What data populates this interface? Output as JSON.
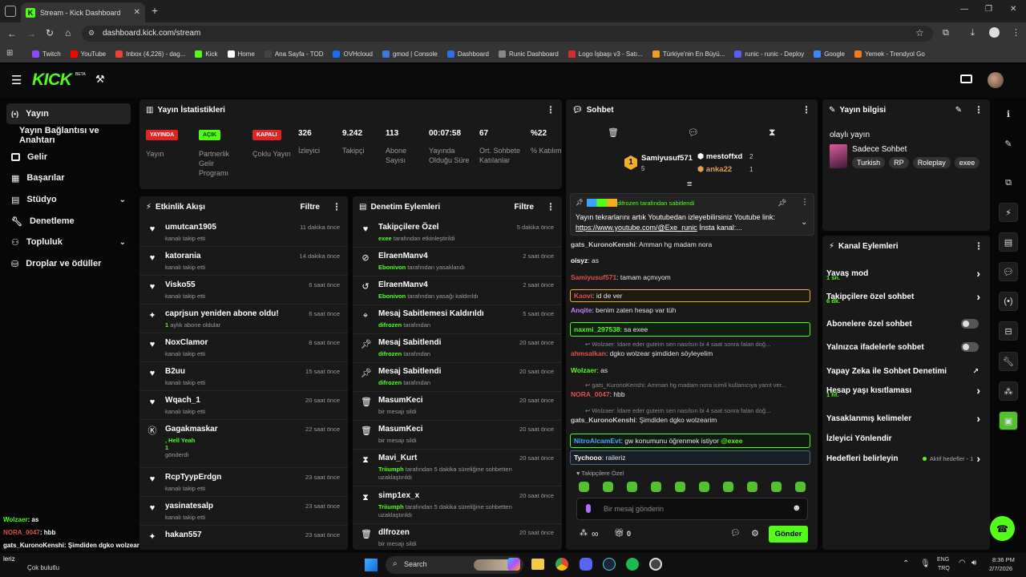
{
  "browser": {
    "tab_title": "Stream - Kick Dashboard",
    "url": "dashboard.kick.com/stream",
    "bookmarks": [
      {
        "label": "Twitch",
        "color": "#9146ff"
      },
      {
        "label": "YouTube",
        "color": "#ff0000"
      },
      {
        "label": "Inbox (4,226) - dag...",
        "color": "#ea4335"
      },
      {
        "label": "Kick",
        "color": "#53fc18"
      },
      {
        "label": "Home",
        "color": "#ffffff"
      },
      {
        "label": "Ana Sayfa - TOD",
        "color": "#444444"
      },
      {
        "label": "OVHcloud",
        "color": "#1c6cf0"
      },
      {
        "label": "gmod | Console",
        "color": "#3a7bd5"
      },
      {
        "label": "Dashboard",
        "color": "#2f6fed"
      },
      {
        "label": "Runic Dashboard",
        "color": "#888888"
      },
      {
        "label": "Logo İşbaşı v3 - Satı...",
        "color": "#d03030"
      },
      {
        "label": "Türkiye'nin En Büyü...",
        "color": "#f0a020"
      },
      {
        "label": "runic - runic - Deploy",
        "color": "#5a5aff"
      },
      {
        "label": "Google",
        "color": "#4285f4"
      },
      {
        "label": "Yemek - Trendyol Go",
        "color": "#f27a1a"
      }
    ]
  },
  "sidebar": {
    "items": [
      {
        "label": "Yayın",
        "icon": "broadcast-icon"
      },
      {
        "label": "Yayın Bağlantısı ve Anahtarı",
        "icon": ""
      },
      {
        "label": "Gelir",
        "icon": "revenue-icon"
      },
      {
        "label": "Başarılar",
        "icon": "achievements-icon"
      },
      {
        "label": "Stüdyo",
        "icon": "studio-icon"
      },
      {
        "label": "Denetleme",
        "icon": "wrench-icon"
      },
      {
        "label": "Topluluk",
        "icon": "community-icon"
      },
      {
        "label": "Droplar ve ödüller",
        "icon": "drops-icon"
      }
    ]
  },
  "stats": {
    "title": "Yayın İstatistikleri",
    "badges": [
      {
        "badge": "YAYINDA",
        "label": "Yayın",
        "color": "#e02424",
        "text": "#ffffff"
      },
      {
        "badge": "AÇIK",
        "label": "Partnerlik Gelir Programı",
        "color": "#53fc18",
        "text": "#0b3d00"
      },
      {
        "badge": "KAPALI",
        "label": "Çoklu Yayın",
        "color": "#e02424",
        "text": "#ffffff"
      }
    ],
    "numbers": [
      {
        "value": "326",
        "label": "İzleyici"
      },
      {
        "value": "9.242",
        "label": "Takipçi"
      },
      {
        "value": "113",
        "label": "Abone Sayısı"
      },
      {
        "value": "00:07:58",
        "label": "Yayında Olduğu Süre"
      },
      {
        "value": "67",
        "label": "Ort. Sohbete Katılanlar"
      },
      {
        "value": "%22",
        "label": "% Katılım"
      }
    ]
  },
  "activity": {
    "title": "Etkinlik Akışı",
    "filter": "Filtre",
    "rows": [
      {
        "name": "umutcan1905",
        "sub": "kanalı takip etti",
        "time": "11 dakika önce",
        "icon": "heart-icon"
      },
      {
        "name": "katorania",
        "sub": "kanalı takip etti",
        "time": "14 dakika önce",
        "icon": "heart-icon"
      },
      {
        "name": "Visko55",
        "sub": "kanalı takip etti",
        "time": "6 saat önce",
        "icon": "heart-icon"
      },
      {
        "name": "caprjsun yeniden abone oldu!",
        "sub_hl": "1",
        "sub": " aylık abone oldular",
        "time": "6 saat önce",
        "icon": "sparkle-icon"
      },
      {
        "name": "NoxClamor",
        "sub": "kanalı takip etti",
        "time": "8 saat önce",
        "icon": "heart-icon"
      },
      {
        "name": "B2uu",
        "sub": "kanalı takip etti",
        "time": "15 saat önce",
        "icon": "heart-icon"
      },
      {
        "name": "Wqach_1",
        "sub": "kanalı takip etti",
        "time": "20 saat önce",
        "icon": "heart-icon"
      },
      {
        "name": "Gagakmaskar",
        "sub_hl": ", Hell Yeah",
        "sub2": "1",
        "sub": "gönderdi",
        "time": "22 saat önce",
        "icon": "kick-icon"
      },
      {
        "name": "RcpTyypErdgn",
        "sub": "kanalı takip etti",
        "time": "23 saat önce",
        "icon": "heart-icon"
      },
      {
        "name": "yasinatesalp",
        "sub": "kanalı takip etti",
        "time": "23 saat önce",
        "icon": "heart-icon"
      },
      {
        "name": "hakan557",
        "sub": "",
        "time": "23 saat önce",
        "icon": "sparkle-icon"
      }
    ]
  },
  "moderation": {
    "title": "Denetim Eylemleri",
    "filter": "Filtre",
    "rows": [
      {
        "name": "Takipçilere Özel",
        "who": "exee",
        "sub": " tarafından etkinleştirildi",
        "time": "5 dakika önce",
        "icon": "heart-icon"
      },
      {
        "name": "ElraenManv4",
        "who": "Ebonivon",
        "sub": " tarafından yasaklandı",
        "time": "2 saat önce",
        "icon": "ban-icon"
      },
      {
        "name": "ElraenManv4",
        "who": "Ebonivon",
        "sub": " tarafından yasağı kaldırıldı",
        "time": "2 saat önce",
        "icon": "undo-icon"
      },
      {
        "name": "Mesaj Sabitlemesi Kaldırıldı",
        "who": "difrozen",
        "sub": " tarafından",
        "time": "5 saat önce",
        "icon": "unpin-icon"
      },
      {
        "name": "Mesaj Sabitlendi",
        "who": "difrozen",
        "sub": " tarafından",
        "time": "20 saat önce",
        "icon": "pin-icon"
      },
      {
        "name": "Mesaj Sabitlendi",
        "who": "difrozen",
        "sub": " tarafından",
        "time": "20 saat önce",
        "icon": "pin-icon"
      },
      {
        "name": "MasumKeci",
        "who": "",
        "sub": "bir mesajı sildi",
        "time": "20 saat önce",
        "icon": "trash-icon"
      },
      {
        "name": "MasumKeci",
        "who": "",
        "sub": "bir mesajı sildi",
        "time": "20 saat önce",
        "icon": "trash-icon"
      },
      {
        "name": "Mavi_Kurt",
        "who": "Triiumph",
        "sub": " tarafından 5 dakika süreliğine sohbetten uzaklaştırıldı",
        "time": "20 saat önce",
        "icon": "hourglass-icon"
      },
      {
        "name": "simp1ex_x",
        "who": "Triiumph",
        "sub": " tarafından 5 dakika süreliğine sohbetten uzaklaştırıldı",
        "time": "20 saat önce",
        "icon": "hourglass-icon"
      },
      {
        "name": "dlfrozen",
        "who": "",
        "sub": "bir mesajı sildi",
        "time": "20 saat önce",
        "icon": "trash-icon"
      }
    ]
  },
  "chat": {
    "title": "Sohbet",
    "leaders": [
      {
        "rank": "1",
        "name": "Samiyusuf571",
        "count": "5"
      },
      {
        "name": "mestoffxd",
        "count": "2"
      },
      {
        "name": "anka22",
        "count": "1"
      }
    ],
    "pinned": {
      "by": "difrozen tarafından sabitlendi",
      "text": "Yayın tekrarlarını artık Youtubedan izleyebilirsiniz Youtube link:",
      "link": "https://www.youtube.com/@Exe_runic",
      "rest": " İnsta kanal:..."
    },
    "messages": [
      {
        "user": "gats_KuronoKenshi",
        "color": "#cfcfcf",
        "text": ": Amman hg madam nora"
      },
      {
        "user": "oisyz",
        "color": "#ffffff",
        "text": ": as"
      },
      {
        "user": "Samiyusuf571",
        "color": "#e05050",
        "text": ": tamam açmıyom"
      },
      {
        "user": "Kaovi",
        "color": "#e05050",
        "text": ": id de ver"
      },
      {
        "user": "Anqite",
        "color": "#c084fc",
        "text": ": benim zaten hesap var tüh"
      },
      {
        "user": "naxmi_297538",
        "color": "#53fc18",
        "text": ": sa exee"
      },
      {
        "reply": "Wolzaer: İdare eder guteim sen nasılsın bi 4 saat sonra falan doğ..."
      },
      {
        "user": "ahmsalkan",
        "color": "#e05050",
        "text": ": dgko wolzear şimdiden söyleyelim"
      },
      {
        "user": "Wolzaer",
        "color": "#53fc18",
        "text": ": as"
      },
      {
        "reply": "gats_KuronoKenshi: Amman hg madam nora isimli kullanıcıya yanıt ver..."
      },
      {
        "user": "NORA_0047",
        "color": "#e05050",
        "text": ": hbb"
      },
      {
        "reply": "Wolzaer: İdare eder guteim sen nasılsın bi 4 saat sonra falan doğ..."
      },
      {
        "user": "gats_KuronoKenshi",
        "color": "#cfcfcf",
        "text": ": Şimdiden dgko wolzearim"
      },
      {
        "user": "NitroAlcamEvt",
        "color": "#4aa3ff",
        "text": ": gw konumunu öğrenmek istiyor ",
        "mention": "@exee"
      },
      {
        "user": "Tychooo",
        "color": "#ffffff",
        "text": ": raileriz"
      }
    ],
    "followers_only": "Takipçilere Özel",
    "input_placeholder": "Bir mesaj gönderin",
    "points": "∞",
    "gifts": "0",
    "send": "Gönder"
  },
  "stream_info": {
    "title": "Yayın bilgisi",
    "stream_title": "olaylı yayın",
    "category": "Sadece Sohbet",
    "tags": [
      "Turkish",
      "RP",
      "Roleplay",
      "exee"
    ]
  },
  "channel_actions": {
    "title": "Kanal Eylemleri",
    "rows": [
      {
        "label": "Yavaş mod",
        "sub": "1 sn.",
        "ctrl": "chevron"
      },
      {
        "label": "Takipçilere özel sohbet",
        "sub": "6 dk.",
        "ctrl": "chevron"
      },
      {
        "label": "Abonelere özel sohbet",
        "sub": "",
        "ctrl": "toggle"
      },
      {
        "label": "Yalnızca ifadelerle sohbet",
        "sub": "",
        "ctrl": "toggle"
      },
      {
        "label": "Yapay Zeka ile Sohbet Denetimi",
        "sub": "",
        "ctrl": "external"
      },
      {
        "label": "Hesap yaşı kısıtlaması",
        "sub": "1 hf.",
        "ctrl": "chevron"
      },
      {
        "label": "Yasaklanmış kelimeler",
        "sub": "",
        "ctrl": "chevron"
      },
      {
        "label": "İzleyici Yönlendir",
        "sub": "",
        "ctrl": ""
      },
      {
        "label": "Hedefleri belirleyin",
        "sub": "",
        "ctrl": "goals"
      }
    ],
    "goals_label": "Aktif hedefler - 1"
  },
  "overlay": {
    "lines": [
      {
        "user": "Wolzaer",
        "color": "#53fc18",
        "text": ": as"
      },
      {
        "user": "NORA_0047",
        "color": "#e05050",
        "text": ": hbb"
      },
      {
        "user": "gats_KuronoKenshi",
        "color": "#ffffff",
        "text": ": Şimdiden dgko wolzearim"
      },
      {
        "user": "NitroAlcamEvt",
        "color": "#4aa3ff",
        "text": ": gw konumunu öğrenmek istiyor @exee"
      }
    ],
    "weather": "Çok bulutlu",
    "weather_prefix": "leriz"
  },
  "taskbar": {
    "search": "Search",
    "lang_top": "ENG",
    "lang_bottom": "TRQ",
    "time": "8:36 PM",
    "date": "2/7/2026"
  }
}
